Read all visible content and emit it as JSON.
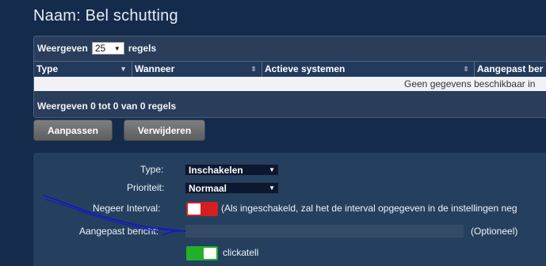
{
  "page": {
    "title": "Naam: Bel schutting"
  },
  "table": {
    "length_prefix": "Weergeven",
    "length_value": "25",
    "length_suffix": "regels",
    "columns": [
      "Type",
      "Wanneer",
      "Actieve systemen",
      "Aangepast ber"
    ],
    "empty_message": "Geen gegevens beschikbaar in",
    "info": "Weergeven 0 tot 0 van 0 regels"
  },
  "buttons": {
    "edit": "Aanpassen",
    "delete": "Verwijderen"
  },
  "form": {
    "type_label": "Type:",
    "type_value": "Inschakelen",
    "priority_label": "Prioriteit:",
    "priority_value": "Normaal",
    "ignore_label": "Negeer Interval:",
    "ignore_state": "off",
    "ignore_note": "(Als ingeschakeld, zal het de interval opgegeven in de instellingen neg",
    "message_label": "Aangepast bericht:",
    "message_value": "",
    "message_note": "(Optioneel)",
    "system_toggle_state": "on",
    "system_name": "clickatell"
  },
  "colors": {
    "background": "#142b4b",
    "toggle_off": "#d41f1f",
    "toggle_on": "#22b02a",
    "annotation": "#1515c8"
  },
  "icons": [
    "sort-icon",
    "dropdown-arrow-icon"
  ]
}
